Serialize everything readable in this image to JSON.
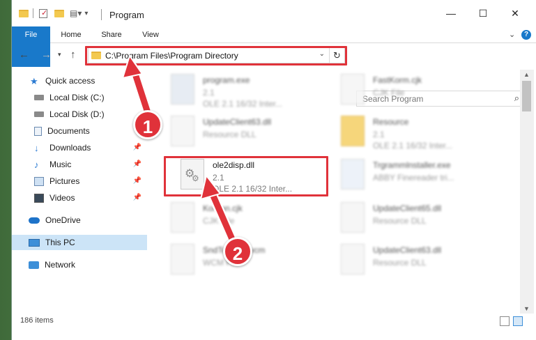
{
  "window": {
    "title": "Program"
  },
  "ribbon": {
    "tabs": [
      "File",
      "Home",
      "Share",
      "View"
    ]
  },
  "address": {
    "path": "C:\\Program Files\\Program Directory"
  },
  "search": {
    "placeholder": "Search Program"
  },
  "sidebar": {
    "items": [
      {
        "label": "Quick access",
        "icon": "star-icon"
      },
      {
        "label": "Local Disk (C:)",
        "icon": "drive-icon"
      },
      {
        "label": "Local Disk (D:)",
        "icon": "drive-icon"
      },
      {
        "label": "Documents",
        "icon": "documents-icon"
      },
      {
        "label": "Downloads",
        "icon": "downloads-icon"
      },
      {
        "label": "Music",
        "icon": "music-icon"
      },
      {
        "label": "Pictures",
        "icon": "pictures-icon"
      },
      {
        "label": "Videos",
        "icon": "videos-icon"
      },
      {
        "label": "OneDrive",
        "icon": "cloud-icon"
      },
      {
        "label": "This PC",
        "icon": "pc-icon"
      },
      {
        "label": "Network",
        "icon": "network-icon"
      }
    ]
  },
  "files": {
    "highlighted": {
      "name": "ole2disp.dll",
      "line2": "2.1",
      "line3": "OLE 2.1 16/32 Inter..."
    },
    "blurred": [
      {
        "name": "program.exe",
        "line2": "2.1",
        "line3": "OLE 2.1 16/32 Inter..."
      },
      {
        "name": "FastKorm.cjk",
        "line2": "CJK File",
        "line3": ""
      },
      {
        "name": "UpdateClient63.dll",
        "line2": "Resource DLL",
        "line3": ""
      },
      {
        "name": "Resource",
        "line2": "2.1",
        "line3": "OLE 2.1 16/32 Inter..."
      },
      {
        "name": "Trgrammlnstaller.exe",
        "line2": "ABBY Finereader tri...",
        "line3": ""
      },
      {
        "name": "Korean.cjk",
        "line2": "CJK File",
        "line3": ""
      },
      {
        "name": "UpdateClient65.dll",
        "line2": "Resource DLL",
        "line3": ""
      },
      {
        "name": "SndToWcm.wcm",
        "line2": "WCM File",
        "line3": ""
      },
      {
        "name": "UpdateClient63.dll",
        "line2": "Resource DLL",
        "line3": ""
      }
    ]
  },
  "status": {
    "count": "186 items"
  },
  "annotations": {
    "step1": "1",
    "step2": "2"
  },
  "colors": {
    "accent": "#1979ca",
    "highlight": "#e0323a",
    "selected": "#cce4f7"
  }
}
